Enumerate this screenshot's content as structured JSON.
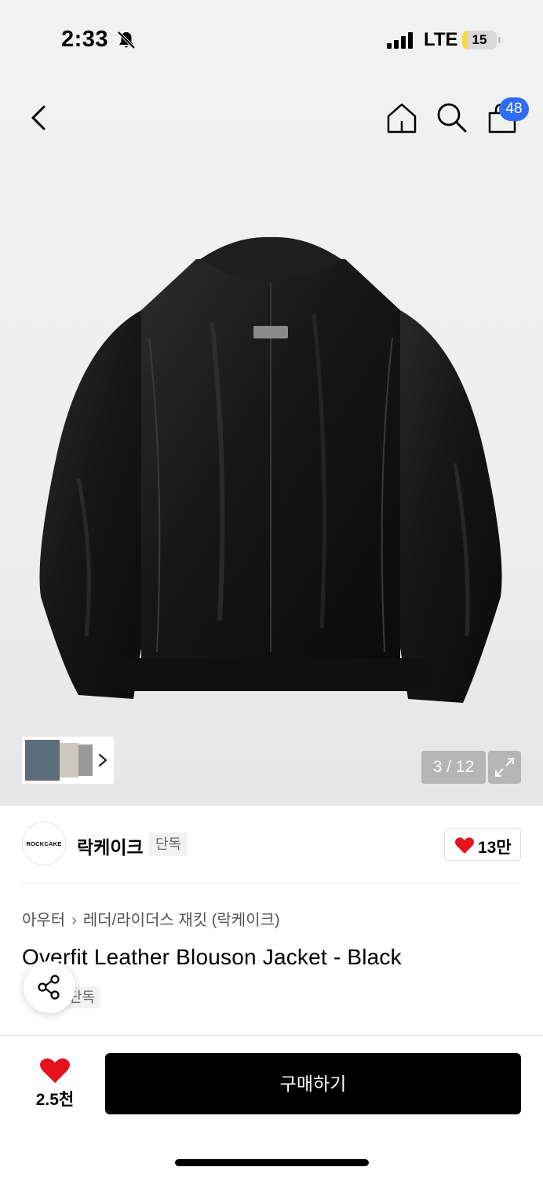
{
  "status_bar": {
    "time": "2:33",
    "network": "LTE",
    "battery": "15",
    "battery_level_percent": 15
  },
  "nav": {
    "cart_count": "48"
  },
  "gallery": {
    "counter": "3 / 12"
  },
  "brand": {
    "logo_text": "ROCKCAKE",
    "name": "락케이크",
    "tag": "단독",
    "like_count": "13만"
  },
  "product": {
    "breadcrumb": [
      "아우터",
      "레더/라이더스 재킷 (락케이크)"
    ],
    "title": "Overfit Leather Blouson Jacket - Black",
    "exclusive_tag": "단독"
  },
  "bottom_bar": {
    "like_count": "2.5천",
    "buy_label": "구매하기"
  },
  "colors": {
    "accent_blue": "#2f6cf6",
    "heart_red": "#e5121c",
    "buy_button": "#000000"
  },
  "icons": [
    "bell-slash-icon",
    "signal-icon",
    "battery-icon",
    "back-arrow-icon",
    "home-icon",
    "search-icon",
    "shopping-bag-icon",
    "chevron-right-icon",
    "expand-icon",
    "heart-icon",
    "share-icon"
  ]
}
